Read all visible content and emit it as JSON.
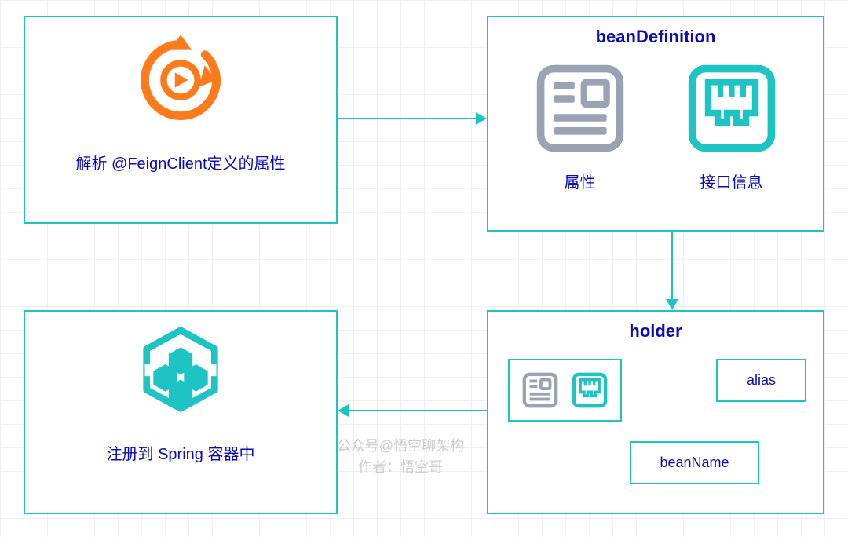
{
  "box1": {
    "caption": "解析 @FeignClient定义的属性"
  },
  "box2": {
    "title": "beanDefinition",
    "label_attr": "属性",
    "label_iface": "接口信息"
  },
  "box3": {
    "title": "holder",
    "alias": "alias",
    "beanName": "beanName"
  },
  "box4": {
    "caption": "注册到 Spring 容器中"
  },
  "watermark": {
    "line1": "公众号@悟空聊架构",
    "line2": "作者：悟空哥"
  }
}
